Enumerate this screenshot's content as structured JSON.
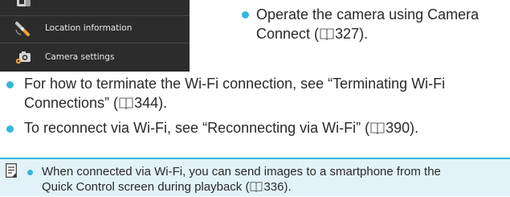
{
  "phone": {
    "rows": [
      {
        "label": "",
        "icon": "phone-camera-icon"
      },
      {
        "label": "Location information",
        "icon": "satellite-icon"
      },
      {
        "label": "Camera settings",
        "icon": "camera-gear-icon"
      }
    ]
  },
  "right_bullet": {
    "line1": "Operate the camera using Camera",
    "line2_pre": "Connect (",
    "line2_ref": "327",
    "line2_post": ")."
  },
  "bullets": [
    {
      "line1": "For how to terminate the Wi-Fi connection, see “Terminating Wi-Fi",
      "line2_pre": "Connections” (",
      "ref": "344",
      "line2_post": ")."
    },
    {
      "line1_pre": "To reconnect via Wi-Fi, see “Reconnecting via Wi-Fi” (",
      "ref": "390",
      "line1_post": ")."
    }
  ],
  "note": {
    "icon": "note-memo-icon",
    "line1": "When connected via Wi-Fi, you can send images to a smartphone from the",
    "line2_pre": "Quick Control screen during playback (",
    "ref": "336",
    "line2_post": ")."
  },
  "colors": {
    "accent": "#33b8dc",
    "note_bg": "#e2f2f8",
    "phone_bg": "#2c2c2c"
  }
}
